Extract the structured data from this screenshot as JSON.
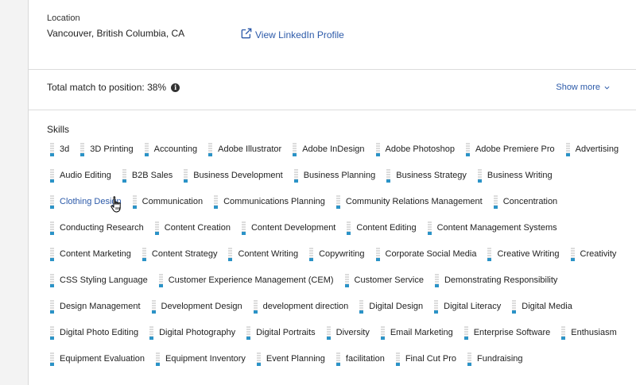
{
  "location": {
    "label": "Location",
    "value": "Vancouver, British Columbia, CA",
    "linkedin_label": "View LinkedIn Profile"
  },
  "match": {
    "title": "Total match to position: 38%",
    "info_glyph": "i",
    "show_more": "Show more"
  },
  "skills": {
    "title": "Skills",
    "hovered_index": 20,
    "items": [
      "3d",
      "3D Printing",
      "Accounting",
      "Adobe Illustrator",
      "Adobe InDesign",
      "Adobe Photoshop",
      "Adobe Premiere Pro",
      "Advertising",
      "Audio Editing",
      "B2B Sales",
      "Business Development",
      "Business Planning",
      "Business Strategy",
      "Business Writing",
      "Clothing Design",
      "Communication",
      "Communications Planning",
      "Community Relations Management",
      "Concentration",
      "Conducting Research",
      "Content Creation",
      "Content Development",
      "Content Editing",
      "Content Management Systems",
      "Content Marketing",
      "Content Strategy",
      "Content Writing",
      "Copywriting",
      "Corporate Social Media",
      "Creative Writing",
      "Creativity",
      "CSS Styling Language",
      "Customer Experience Management (CEM)",
      "Customer Service",
      "Demonstrating Responsibility",
      "Design Management",
      "Development Design",
      "development direction",
      "Digital Design",
      "Digital Literacy",
      "Digital Media",
      "Digital Photo Editing",
      "Digital Photography",
      "Digital Portraits",
      "Diversity",
      "Email Marketing",
      "Enterprise Software",
      "Enthusiasm",
      "Equipment Evaluation",
      "Equipment Inventory",
      "Event Planning",
      "facilitation",
      "Final Cut Pro",
      "Fundraising"
    ]
  },
  "colors": {
    "link": "#2c5aa9",
    "meter_fill": "#2b93c7"
  }
}
